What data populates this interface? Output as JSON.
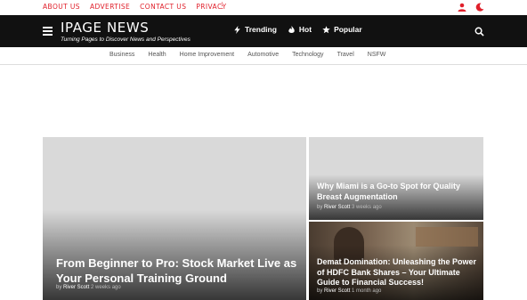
{
  "top_links": [
    "ABOUT US",
    "ADVERTISE",
    "CONTACT US",
    "PRIVACY"
  ],
  "kebab": "⋮",
  "brand": {
    "title": "IPAGE NEWS",
    "tagline": "Turning Pages to Discover News and Perspectives"
  },
  "header_nav": [
    "Trending",
    "Hot",
    "Popular"
  ],
  "categories": [
    "Business",
    "Health",
    "Home Improvement",
    "Automotive",
    "Technology",
    "Travel",
    "NSFW"
  ],
  "posts": [
    {
      "title": "From Beginner to Pro: Stock Market Live as Your Personal Training Ground",
      "by": "by",
      "author": "River Scott",
      "ago": "2 weeks ago"
    },
    {
      "title": "Why Miami is a Go-to Spot for Quality Breast Augmentation",
      "by": "by",
      "author": "River Scott",
      "ago": "3 weeks ago"
    },
    {
      "title": "Demat Domination: Unleashing the Power of HDFC Bank Shares – Your Ultimate Guide to Financial Success!",
      "by": "by",
      "author": "River Scott",
      "ago": "1 month ago"
    }
  ],
  "colors": {
    "accent": "#e0202b",
    "header_bg": "#111111"
  }
}
